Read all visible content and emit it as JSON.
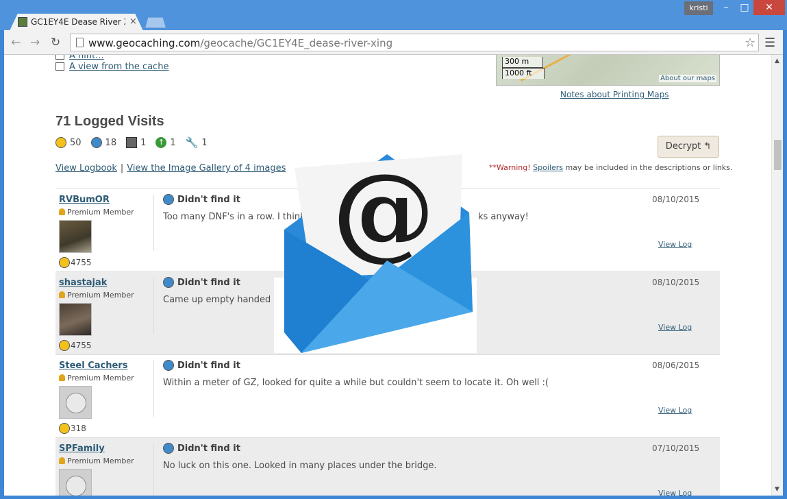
{
  "browser": {
    "tab_title": "GC1EY4E Dease River Xing",
    "tab_close": "×",
    "user_badge": "kristi",
    "url_host": "www.geocaching.com",
    "url_path": "/geocache/GC1EY4E_dease-river-xing",
    "icons": [
      "back-arrow-icon",
      "forward-arrow-icon",
      "reload-icon",
      "page-icon",
      "bookmark-star-icon",
      "menu-icon",
      "minimize-icon",
      "maximize-icon",
      "close-icon"
    ]
  },
  "page": {
    "hint_link": "A hint...",
    "view_link": "A view from the cache",
    "map": {
      "scale_m": "300 m",
      "scale_ft": "1000 ft",
      "about_maps": "About our maps"
    },
    "notes_printing": "Notes about Printing Maps",
    "logged_title": "71 Logged Visits",
    "counts": [
      {
        "icon": "found-it-icon",
        "value": "50"
      },
      {
        "icon": "didnt-find-icon",
        "value": "18"
      },
      {
        "icon": "write-note-icon",
        "value": "1"
      },
      {
        "icon": "publish-icon",
        "value": "1"
      },
      {
        "icon": "maintenance-icon",
        "value": "1"
      }
    ],
    "decrypt_label": "Decrypt",
    "decrypt_glyph": "↰",
    "logbook_link": "View Logbook",
    "gallery_link": "View the Image Gallery of 4 images",
    "separator": "|",
    "warning_prefix": "**Warning!",
    "warning_link": "Spoilers",
    "warning_suffix": " may be included in the descriptions or links."
  },
  "logs": [
    {
      "user": "RVBumOR",
      "member": "Premium Member",
      "finds": "4755",
      "type": "Didn't find it",
      "date": "08/10/2015",
      "text": "Too many DNF's in a row. I think",
      "text_tail": "ks anyway!",
      "view": "View Log"
    },
    {
      "user": "shastajak",
      "member": "Premium Member",
      "finds": "4755",
      "type": "Didn't find it",
      "date": "08/10/2015",
      "text": "Came up empty handed or",
      "view": "View Log"
    },
    {
      "user": "Steel Cachers",
      "member": "Premium Member",
      "finds": "318",
      "type": "Didn't find it",
      "date": "08/06/2015",
      "text": "Within a meter of GZ, looked for quite a while but couldn't seem to locate it. Oh well :(",
      "view": "View Log"
    },
    {
      "user": "SPFamily",
      "member": "Premium Member",
      "finds": "",
      "type": "Didn't find it",
      "date": "07/10/2015",
      "text": "No luck on this one. Looked in many places under the bridge.",
      "view": "View Log"
    }
  ],
  "overlay": {
    "email_symbol": "@",
    "colors": {
      "envelope_dark": "#1f7fd0",
      "envelope_light": "#4aa8ea",
      "paper": "#f4f4f4"
    }
  }
}
